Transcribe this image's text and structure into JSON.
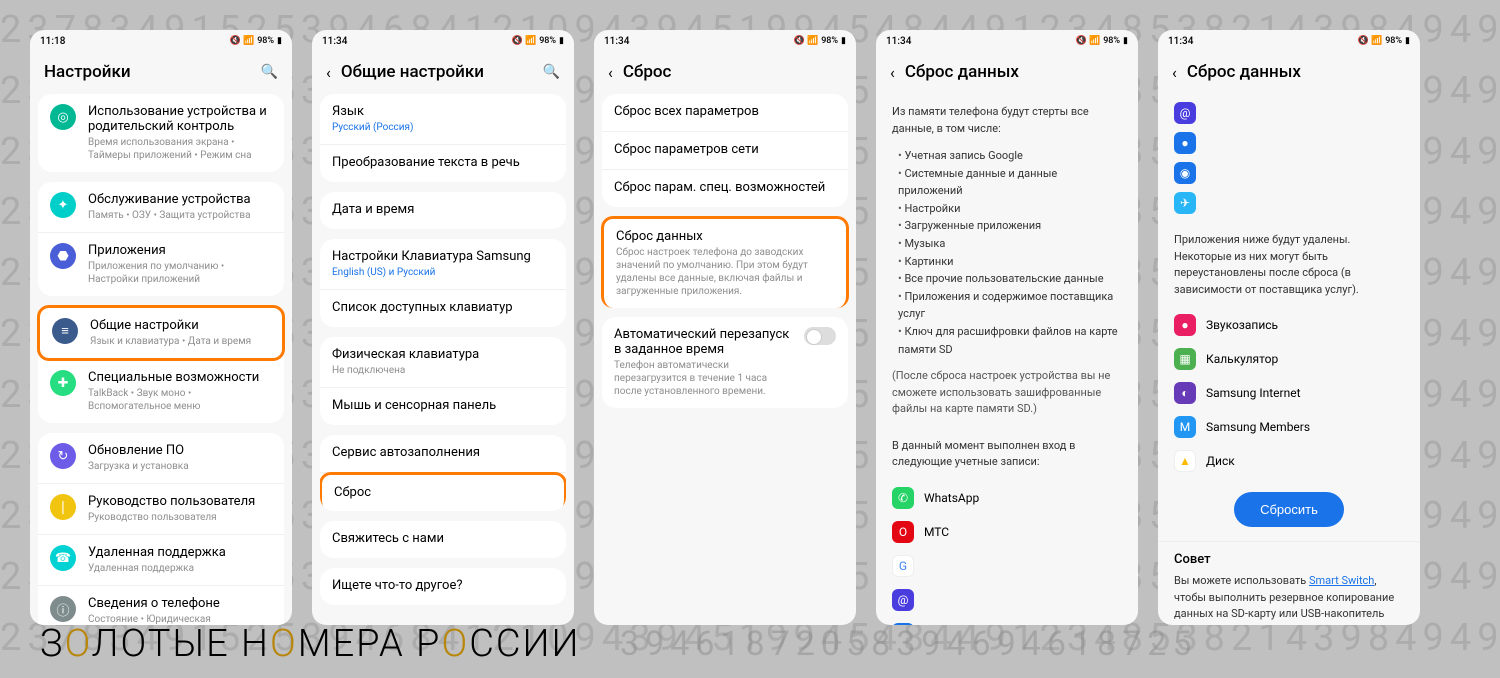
{
  "background_digits": "2378349152539468412109439451994548449123485382143984949015393187821073791",
  "footer_digits": "39461872058394694618725",
  "logo": {
    "pre": "З",
    "gold": "О",
    "mid": "ЛОТЫЕ Н",
    "gold2": "О",
    "mid2": "МЕРА Р",
    "gold3": "О",
    "tail": "ССИИ"
  },
  "phone1": {
    "time": "11:18",
    "battery": "98%",
    "header": "Настройки",
    "items": [
      {
        "title": "Использование устройства и родительский контроль",
        "sub": "Время использования экрана • Таймеры приложений • Режим сна",
        "icon": "ic-green",
        "glyph": "◎"
      },
      {
        "title": "Обслуживание устройства",
        "sub": "Память • ОЗУ • Защита устройства",
        "icon": "ic-teal",
        "glyph": "✦"
      },
      {
        "title": "Приложения",
        "sub": "Приложения по умолчанию • Настройки приложений",
        "icon": "ic-blue",
        "glyph": "⬣"
      },
      {
        "title": "Общие настройки",
        "sub": "Язык и клавиатура • Дата и время",
        "icon": "ic-dblue",
        "glyph": "≡",
        "highlight": true
      },
      {
        "title": "Специальные возможности",
        "sub": "TalkBack • Звук моно • Вспомогательное меню",
        "icon": "ic-mint",
        "glyph": "✚"
      },
      {
        "title": "Обновление ПО",
        "sub": "Загрузка и установка",
        "icon": "ic-purp",
        "glyph": "↻"
      },
      {
        "title": "Руководство пользователя",
        "sub": "Руководство пользователя",
        "icon": "ic-yell",
        "glyph": "❘"
      },
      {
        "title": "Удаленная поддержка",
        "sub": "Удаленная поддержка",
        "icon": "ic-cyan",
        "glyph": "☎"
      },
      {
        "title": "Сведения о телефоне",
        "sub": "Состояние • Юридическая информация • Имя телефона",
        "icon": "ic-grey",
        "glyph": "ⓘ"
      }
    ]
  },
  "phone2": {
    "time": "11:34",
    "battery": "98%",
    "header": "Общие настройки",
    "items": [
      {
        "title": "Язык",
        "sub": "Русский (Россия)",
        "sub_blue": true
      },
      {
        "title": "Преобразование текста в речь"
      },
      {
        "title": "Дата и время"
      },
      {
        "title": "Настройки Клавиатура Samsung",
        "sub": "English (US) и Русский",
        "sub_blue": true
      },
      {
        "title": "Список доступных клавиатур"
      },
      {
        "title": "Физическая клавиатура",
        "sub": "Не подключена"
      },
      {
        "title": "Мышь и сенсорная панель"
      },
      {
        "title": "Сервис автозаполнения"
      },
      {
        "title": "Сброс",
        "highlight": true
      },
      {
        "title": "Свяжитесь с нами"
      },
      {
        "title": "Ищете что-то другое?"
      }
    ]
  },
  "phone3": {
    "time": "11:34",
    "battery": "98%",
    "header": "Сброс",
    "items": [
      {
        "title": "Сброс всех параметров"
      },
      {
        "title": "Сброс параметров сети"
      },
      {
        "title": "Сброс парам. спец. возможностей"
      },
      {
        "title": "Сброс данных",
        "sub": "Сброс настроек телефона до заводских значений по умолчанию. При этом будут удалены все данные, включая файлы и загруженные приложения.",
        "highlight": true
      },
      {
        "title": "Автоматический перезапуск в заданное время",
        "sub": "Телефон автоматически перезагрузится в течение 1 часа после установленного времени.",
        "toggle": true
      }
    ]
  },
  "phone4": {
    "time": "11:34",
    "battery": "98%",
    "header": "Сброс данных",
    "intro": "Из памяти телефона будут стерты все данные, в том числе:",
    "bullets": [
      "Учетная запись Google",
      "Системные данные и данные приложений",
      "Настройки",
      "Загруженные приложения",
      "Музыка",
      "Картинки",
      "Все прочие пользовательские данные",
      "Приложения и содержимое поставщика услуг",
      "Ключ для расшифровки файлов на карте памяти SD"
    ],
    "note": "(После сброса настроек устройства вы не сможете использовать зашифрованные файлы на карте памяти SD.)",
    "accounts_intro": "В данный момент выполнен вход в следующие учетные записи:",
    "accounts": [
      {
        "name": "WhatsApp",
        "bg": "#25d366",
        "glyph": "✆"
      },
      {
        "name": "МТС",
        "bg": "#e30613",
        "glyph": "O"
      },
      {
        "name": "",
        "bg": "#fff",
        "glyph": "G",
        "g_color": true
      },
      {
        "name": "",
        "bg": "#4a3de0",
        "glyph": "@"
      },
      {
        "name": "",
        "bg": "#1a73e8",
        "glyph": "●"
      },
      {
        "name": "",
        "bg": "#1a73e8",
        "glyph": "◉"
      }
    ]
  },
  "phone5": {
    "time": "11:34",
    "battery": "98%",
    "header": "Сброс данных",
    "top_icons": [
      {
        "bg": "#4a3de0",
        "glyph": "@"
      },
      {
        "bg": "#1a73e8",
        "glyph": "●"
      },
      {
        "bg": "#1a73e8",
        "glyph": "◉"
      },
      {
        "bg": "#29b6f6",
        "glyph": "✈"
      }
    ],
    "apps_intro": "Приложения ниже будут удалены. Некоторые из них могут быть переустановлены после сброса (в зависимости от поставщика услуг).",
    "apps": [
      {
        "name": "Звукозапись",
        "bg": "#e91e63",
        "glyph": "●"
      },
      {
        "name": "Калькулятор",
        "bg": "#4caf50",
        "glyph": "▦"
      },
      {
        "name": "Samsung Internet",
        "bg": "#673ab7",
        "glyph": "◐"
      },
      {
        "name": "Samsung Members",
        "bg": "#2196f3",
        "glyph": "M"
      },
      {
        "name": "Диск",
        "bg": "#fff",
        "glyph": "▲",
        "tri": true
      }
    ],
    "reset_label": "Сбросить",
    "tip_title": "Совет",
    "tip_body_pre": "Вы можете использовать ",
    "tip_link": "Smart Switch",
    "tip_body_post": ", чтобы выполнить резервное копирование данных на SD-карту или USB-накопитель перед сбросом параметров телефона."
  }
}
